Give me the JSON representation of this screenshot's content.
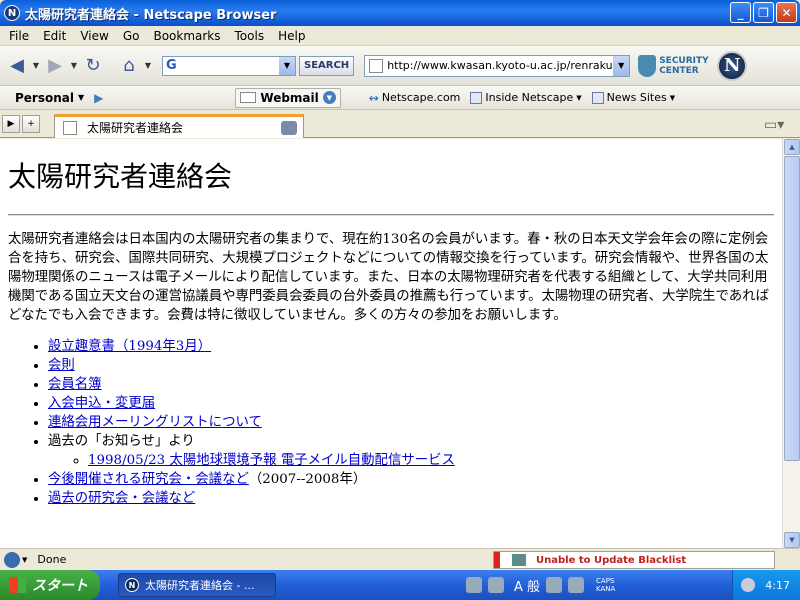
{
  "window": {
    "title": "太陽研究者連絡会 - Netscape Browser",
    "app_icon_letter": "N",
    "minimize": "_",
    "maximize": "❐",
    "close": "✕"
  },
  "menu": {
    "items": [
      "File",
      "Edit",
      "View",
      "Go",
      "Bookmarks",
      "Tools",
      "Help"
    ]
  },
  "navbar": {
    "search_logo": "G",
    "search_button": "SEARCH",
    "url": "http://www.kwasan.kyoto-u.ac.jp/renrakukai/",
    "security_label": "SECURITY CENTER",
    "logo_letter": "N"
  },
  "personal": {
    "label": "Personal",
    "webmail": "Webmail",
    "bookmarks": [
      "Netscape.com",
      "Inside Netscape",
      "News Sites"
    ]
  },
  "tabs": [
    {
      "label": "太陽研究者連絡会",
      "active": true
    }
  ],
  "page": {
    "heading": "太陽研究者連絡会",
    "intro": "太陽研究者連絡会は日本国内の太陽研究者の集まりで、現在約130名の会員がいます。春・秋の日本天文学会年会の際に定例会合を持ち、研究会、国際共同研究、大規模プロジェクトなどについての情報交換を行っています。研究会情報や、世界各国の太陽物理関係のニュースは電子メールにより配信しています。また、日本の太陽物理研究者を代表する組織として、大学共同利用機関である国立天文台の運営協議員や専門委員会委員の台外委員の推薦も行っています。太陽物理の研究者、大学院生であればどなたでも入会できます。会費は特に徴収していません。多くの方々の参加をお願いします。",
    "links": {
      "prospectus": "設立趣意書（1994年3月）",
      "rules": "会則",
      "members": "会員名簿",
      "join": "入会申込・変更届",
      "mailing_list": "連絡会用メーリングリストについて",
      "news_prefix": "過去の「お知らせ」より",
      "news_item": "1998/05/23 太陽地球環境予報 電子メイル自動配信サービス",
      "upcoming": "今後開催される研究会・会議など",
      "upcoming_suffix": "（2007--2008年）",
      "past": "過去の研究会・会議など"
    }
  },
  "status": {
    "text": "Done",
    "blacklist": "Unable to Update Blacklist"
  },
  "taskbar": {
    "start": "スタート",
    "task_title": "太陽研究者連絡会 - ...",
    "ime": "A 般",
    "caps": "CAPS",
    "kana": "KANA",
    "clock": "4:17"
  }
}
